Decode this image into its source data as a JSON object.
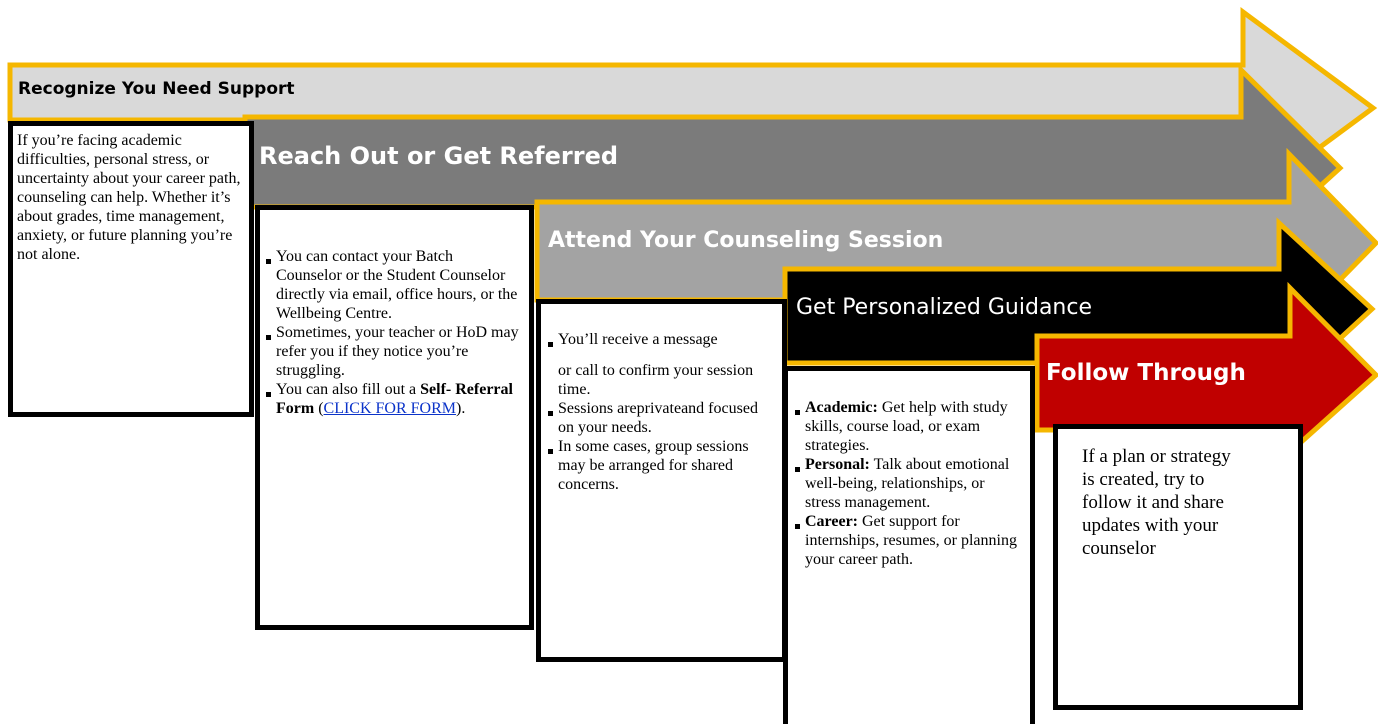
{
  "colors": {
    "border_gold": "#f5b700",
    "arrow_light": "#d9d9d9",
    "arrow_dark": "#7b7b7b",
    "arrow_mid": "#a3a3a3",
    "arrow_black": "#000000",
    "arrow_red": "#c00000",
    "link_blue": "#0b33c9"
  },
  "steps": [
    {
      "title": "Recognize You Need Support",
      "text": "If you’re facing academic difficulties, personal stress, or uncertainty about your career path, counseling can help. Whether it’s about grades, time management, anxiety, or future planning you’re not alone."
    },
    {
      "title": "Reach Out or Get Referred",
      "bullets": [
        "You can contact your Batch Counselor or the Student Counselor directly via email, office hours, or the Wellbeing Centre.",
        "Sometimes, your teacher or HoD may refer you if they notice you’re struggling."
      ],
      "bullet3_prefix": "You can also fill out a",
      "bullet3_bold": "Self- Referral Form",
      "bullet3_open": "(",
      "bullet3_link": "CLICK FOR FORM",
      "bullet3_close": ")."
    },
    {
      "title": "Attend Your Counseling Session",
      "bullet1_line1": "You’ll receive a message",
      "bullet1_line2": "or call to confirm your session time.",
      "bullets": [
        "Sessions areprivateand focused on your needs.",
        "In some cases, group sessions may be arranged for shared concerns."
      ]
    },
    {
      "title": "Get Personalized Guidance",
      "items": [
        {
          "label": "Academic:",
          "text": "Get help with study skills, course load, or exam strategies."
        },
        {
          "label": "Personal:",
          "text": "Talk about emotional well-being, relationships, or stress management."
        },
        {
          "label": "Career:",
          "text": "Get support for internships, resumes, or planning your career path."
        }
      ]
    },
    {
      "title": "Follow Through",
      "text": "If a plan or strategy is created, try to follow it and share updates with your counselor"
    }
  ]
}
